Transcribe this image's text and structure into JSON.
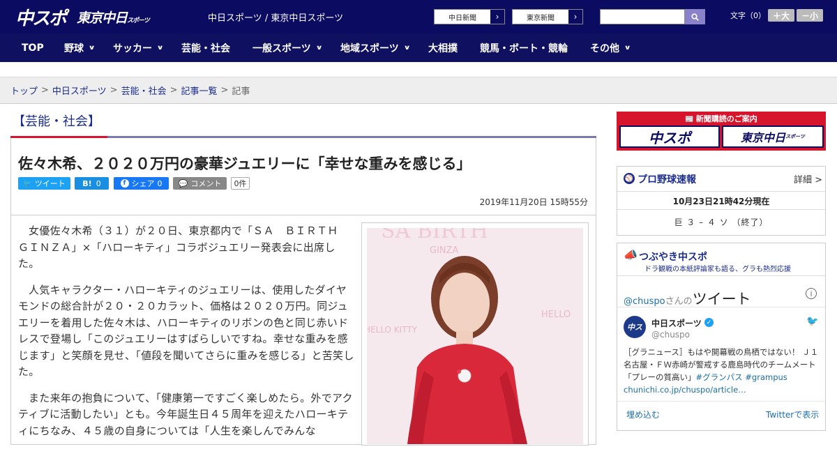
{
  "header": {
    "logo_main": "中スポ",
    "logo_sub": "東京中日",
    "logo_sub_small": "スポーツ",
    "site_link": "中日スポーツ / 東京中日スポーツ",
    "paper_buttons": [
      "中日新聞",
      "東京新聞"
    ],
    "search_placeholder": "",
    "font_size_label": "文字（0）",
    "font_up": "＋大",
    "font_down": "－小"
  },
  "nav": {
    "items": [
      {
        "label": "TOP",
        "dropdown": false
      },
      {
        "label": "野球",
        "dropdown": true
      },
      {
        "label": "サッカー",
        "dropdown": true
      },
      {
        "label": "芸能・社会",
        "dropdown": false
      },
      {
        "label": "一般スポーツ",
        "dropdown": true
      },
      {
        "label": "地域スポーツ",
        "dropdown": true
      },
      {
        "label": "大相撲",
        "dropdown": false
      },
      {
        "label": "競馬・ボート・競輪",
        "dropdown": false
      },
      {
        "label": "その他",
        "dropdown": true
      }
    ]
  },
  "breadcrumb": {
    "items": [
      "トップ",
      "中日スポーツ",
      "芸能・社会",
      "記事一覧"
    ],
    "current": "記事"
  },
  "article": {
    "category": "【芸能・社会】",
    "headline": "佐々木希、２０２０万円の豪華ジュエリーに「幸せな重みを感じる」",
    "share": {
      "tweet": "ツイート",
      "hatena": "B!",
      "hatena_count": "0",
      "facebook": "シェア",
      "facebook_count": "0",
      "comment": "コメント",
      "comment_count": "0件"
    },
    "date": "2019年11月20日 15時55分",
    "paragraphs": [
      "女優佐々木希（３１）が２０日、東京都内で「ＳＡ　ＢＩＲＴＨ　ＧＩＮＺＡ」×「ハローキティ」コラボジュエリー発表会に出席した。",
      "人気キャラクター・ハローキティのジュエリーは、使用したダイヤモンドの総合計が２０・２０カラット、価格は２０２０万円。同ジュエリーを着用した佐々木は、ハローキティのリボンの色と同じ赤いドレスで登場し「このジュエリーはすばらしいですね。幸せな重みを感じます」と笑顔を見せ、「値段を聞いてさらに重みを感じる」と苦笑した。",
      "また来年の抱負について、「健康第一ですごく楽しめたら。外でアクティブに活動したい」とも。今年誕生日４５周年を迎えたハローキティにちなみ、４５歳の自身については「人生を楽しんでみんな"
    ],
    "photo_backdrop": [
      "SA BIRTH",
      "GINZA",
      "HELLO KITTY"
    ]
  },
  "sidebar": {
    "subscription_title": "新聞購読のご案内",
    "sub_logos": [
      "中スポ",
      "東京中日"
    ],
    "sub_logo_small": "スポーツ",
    "baseball": {
      "title": "プロ野球速報",
      "more": "詳細 >",
      "time": "10月23日21時42分現在",
      "score": "巨 ３ – ４ ソ （終了）"
    },
    "twitter": {
      "title": "つぶやき中スポ",
      "subtitle": "ドラ観戦の本紙評論家も語る、グラも熱烈応援",
      "handle": "@chuspo",
      "handle_suffix": "さんの",
      "tweets_word": "ツイート",
      "account_name": "中日スポーツ",
      "account_at": "@chuspo",
      "avatar_text": "中ス",
      "tweet_text": "［グラニュース］もはや開幕戦の鳥栖ではない！ Ｊ１名古屋・ＦＷ赤崎が警戒する鹿島時代のチームメート「プレーの質高い」",
      "tweet_hashtags": "#グランパス #grampus",
      "tweet_link": "chunichi.co.jp/chuspo/article…",
      "embed": "埋め込む",
      "view_on_twitter": "Twitterで表示"
    }
  },
  "colors": {
    "header_bg": "#0b0b62",
    "nav_bg": "#101060",
    "accent_red": "#d6142c",
    "link_blue": "#1a2c8c",
    "twitter_blue": "#1da1f2",
    "facebook_blue": "#1877f2"
  }
}
